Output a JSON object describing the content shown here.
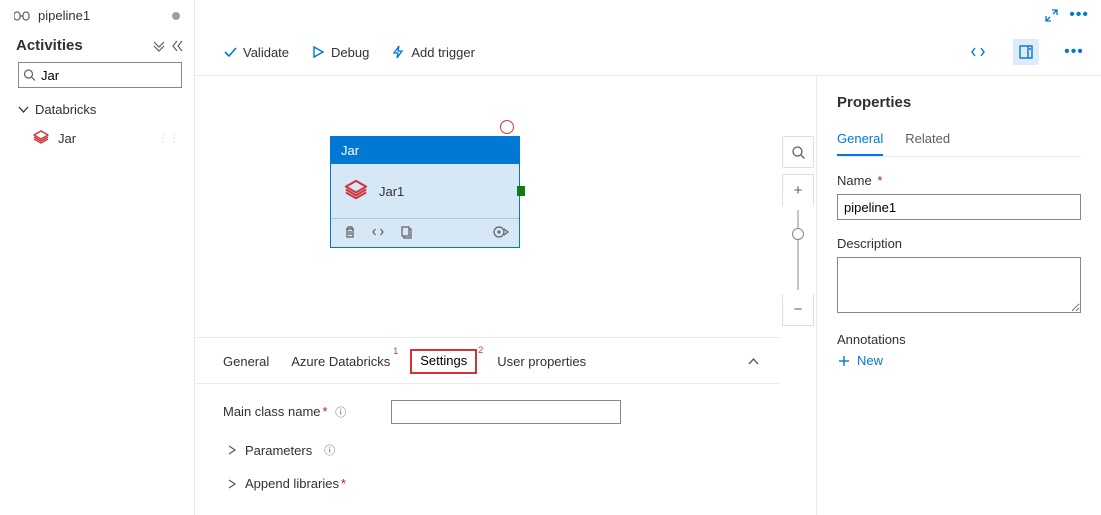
{
  "header": {
    "pipeline_name": "pipeline1"
  },
  "activities": {
    "title": "Activities",
    "search_value": "Jar",
    "category": "Databricks",
    "item": "Jar"
  },
  "toolbar": {
    "validate": "Validate",
    "debug": "Debug",
    "add_trigger": "Add trigger"
  },
  "node": {
    "type": "Jar",
    "name": "Jar1"
  },
  "config_tabs": {
    "general": "General",
    "azure_databricks": "Azure Databricks",
    "settings": "Settings",
    "user_props": "User properties",
    "sup1": "1",
    "sup2": "2"
  },
  "settings": {
    "main_class_label": "Main class name",
    "main_class_value": "",
    "parameters": "Parameters",
    "append_libs": "Append libraries"
  },
  "properties": {
    "title": "Properties",
    "tab_general": "General",
    "tab_related": "Related",
    "name_label": "Name",
    "name_value": "pipeline1",
    "desc_label": "Description",
    "desc_value": "",
    "annotations_label": "Annotations",
    "new_label": "New"
  }
}
